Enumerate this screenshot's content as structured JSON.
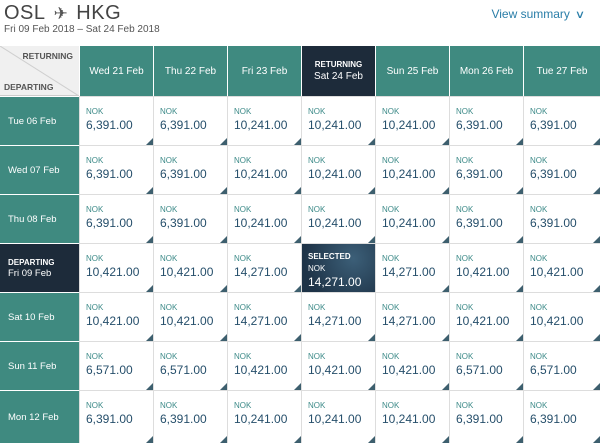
{
  "header": {
    "origin": "OSL",
    "destination": "HKG",
    "plane_icon": "airplane-icon",
    "dates": "Fri 09 Feb 2018 – Sat 24 Feb 2018",
    "view_summary": "View summary"
  },
  "grid": {
    "returning_label": "RETURNING",
    "departing_label": "DEPARTING",
    "selected_label": "SELECTED",
    "currency": "NOK",
    "columns": [
      {
        "label": "Wed 21 Feb",
        "tag": ""
      },
      {
        "label": "Thu 22 Feb",
        "tag": ""
      },
      {
        "label": "Fri 23 Feb",
        "tag": ""
      },
      {
        "label": "Sat 24 Feb",
        "tag": "RETURNING"
      },
      {
        "label": "Sun 25 Feb",
        "tag": ""
      },
      {
        "label": "Mon 26 Feb",
        "tag": ""
      },
      {
        "label": "Tue 27 Feb",
        "tag": ""
      }
    ],
    "rows": [
      {
        "label": "Tue 06 Feb",
        "tag": "",
        "prices": [
          "6,391.00",
          "6,391.00",
          "10,241.00",
          "10,241.00",
          "10,241.00",
          "6,391.00",
          "6,391.00"
        ]
      },
      {
        "label": "Wed 07 Feb",
        "tag": "",
        "prices": [
          "6,391.00",
          "6,391.00",
          "10,241.00",
          "10,241.00",
          "10,241.00",
          "6,391.00",
          "6,391.00"
        ]
      },
      {
        "label": "Thu 08 Feb",
        "tag": "",
        "prices": [
          "6,391.00",
          "6,391.00",
          "10,241.00",
          "10,241.00",
          "10,241.00",
          "6,391.00",
          "6,391.00"
        ]
      },
      {
        "label": "Fri 09 Feb",
        "tag": "DEPARTING",
        "prices": [
          "10,421.00",
          "10,421.00",
          "14,271.00",
          "14,271.00",
          "14,271.00",
          "10,421.00",
          "10,421.00"
        ]
      },
      {
        "label": "Sat 10 Feb",
        "tag": "",
        "prices": [
          "10,421.00",
          "10,421.00",
          "14,271.00",
          "14,271.00",
          "14,271.00",
          "10,421.00",
          "10,421.00"
        ]
      },
      {
        "label": "Sun 11 Feb",
        "tag": "",
        "prices": [
          "6,571.00",
          "6,571.00",
          "10,421.00",
          "10,421.00",
          "10,421.00",
          "6,571.00",
          "6,571.00"
        ]
      },
      {
        "label": "Mon 12 Feb",
        "tag": "",
        "prices": [
          "6,391.00",
          "6,391.00",
          "10,241.00",
          "10,241.00",
          "10,241.00",
          "6,391.00",
          "6,391.00"
        ]
      }
    ],
    "selected": {
      "row": 3,
      "col": 3
    }
  },
  "colors": {
    "teal_header": "#3f8a80",
    "navy_selected": "#1d2b3a",
    "price_text": "#264f6b",
    "link": "#2a7ea8"
  }
}
